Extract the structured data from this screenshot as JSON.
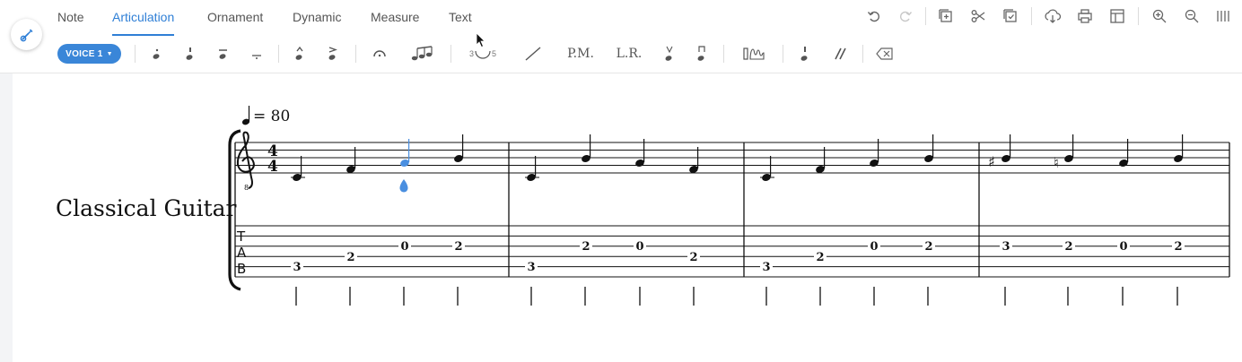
{
  "tabs": [
    {
      "label": "Note",
      "active": false
    },
    {
      "label": "Articulation",
      "active": true
    },
    {
      "label": "Ornament",
      "active": false
    },
    {
      "label": "Dynamic",
      "active": false
    },
    {
      "label": "Measure",
      "active": false
    },
    {
      "label": "Text",
      "active": false
    }
  ],
  "top_icons": [
    "undo-icon",
    "redo-icon",
    "add-measure-icon",
    "cut-icon",
    "paste-icon",
    "download-icon",
    "print-icon",
    "layout-icon",
    "zoom-in-icon",
    "zoom-out-icon",
    "columns-icon"
  ],
  "voice": {
    "label": "VOICE 1"
  },
  "articulations": {
    "pm_label": "P.M.",
    "lr_label": "L.R.",
    "tuplet_left": "3",
    "tuplet_right": "5"
  },
  "score": {
    "instrument": "Classical Guitar",
    "tempo": "= 80",
    "tab_clef": [
      "T",
      "A",
      "B"
    ],
    "measures": [
      {
        "tab": [
          {
            "fret": "3",
            "string": 5
          },
          {
            "fret": "2",
            "string": 4
          },
          {
            "fret": "0",
            "string": 3
          },
          {
            "fret": "2",
            "string": 3
          }
        ]
      },
      {
        "tab": [
          {
            "fret": "3",
            "string": 5
          },
          {
            "fret": "2",
            "string": 3
          },
          {
            "fret": "0",
            "string": 3
          },
          {
            "fret": "2",
            "string": 4
          }
        ]
      },
      {
        "tab": [
          {
            "fret": "3",
            "string": 5
          },
          {
            "fret": "2",
            "string": 4
          },
          {
            "fret": "0",
            "string": 3
          },
          {
            "fret": "2",
            "string": 3
          }
        ]
      },
      {
        "tab": [
          {
            "fret": "3",
            "string": 3
          },
          {
            "fret": "2",
            "string": 3
          },
          {
            "fret": "0",
            "string": 3
          },
          {
            "fret": "2",
            "string": 3
          }
        ]
      }
    ]
  },
  "colors": {
    "accent": "#2f7fd6",
    "selected_note": "#4a8fe0"
  }
}
